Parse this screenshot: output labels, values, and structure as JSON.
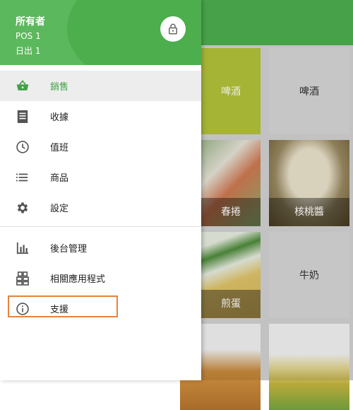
{
  "drawer": {
    "owner": "所有者",
    "pos": "POS 1",
    "shift": "日出 1",
    "lock_icon": "lock-icon",
    "items": [
      {
        "label": "銷售",
        "icon": "basket-icon",
        "active": true
      },
      {
        "label": "收據",
        "icon": "receipt-icon"
      },
      {
        "label": "值班",
        "icon": "clock-icon"
      },
      {
        "label": "商品",
        "icon": "list-icon"
      },
      {
        "label": "設定",
        "icon": "gear-icon"
      },
      {
        "label": "後台管理",
        "icon": "bar-chart-icon"
      },
      {
        "label": "相關應用程式",
        "icon": "apps-icon"
      },
      {
        "label": "支援",
        "icon": "info-icon"
      }
    ]
  },
  "products": {
    "beer1": "啤酒",
    "beer2": "啤酒",
    "spring_roll": "春捲",
    "walnut_sauce": "核桃醬",
    "omelette": "煎蛋",
    "milk": "牛奶"
  },
  "colors": {
    "primary": "#4caf50",
    "accent_highlight": "#e8823a",
    "active_text": "#43a047"
  }
}
